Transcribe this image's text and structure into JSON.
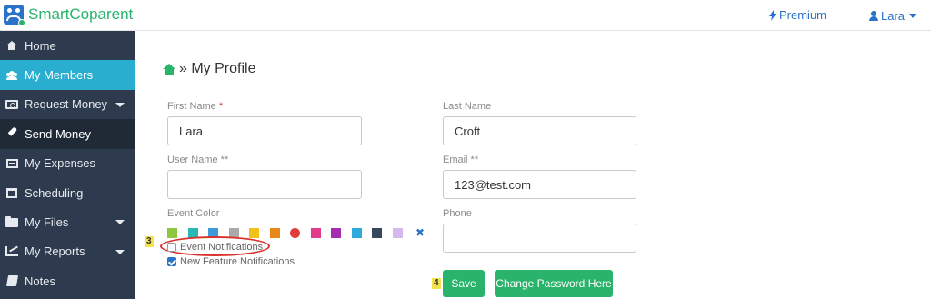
{
  "app": {
    "name": "SmartCoparent"
  },
  "header": {
    "premium_label": "Premium",
    "user_label": "Lara"
  },
  "sidebar": {
    "items": [
      {
        "label": "Home"
      },
      {
        "label": "My Members"
      },
      {
        "label": "Request Money"
      },
      {
        "label": "Send Money"
      },
      {
        "label": "My Expenses"
      },
      {
        "label": "Scheduling"
      },
      {
        "label": "My Files"
      },
      {
        "label": "My Reports"
      },
      {
        "label": "Notes"
      }
    ]
  },
  "main": {
    "breadcrumb": "» My Profile",
    "form": {
      "first_name_label": "First Name",
      "required_marker": "*",
      "first_name_value": "Lara",
      "last_name_label": "Last Name",
      "last_name_value": "Croft",
      "user_name_label": "User Name **",
      "user_name_value": "",
      "email_label": "Email **",
      "email_value": "123@test.com",
      "event_color_label": "Event Color",
      "phone_label": "Phone",
      "phone_value": "",
      "event_colors": [
        "#8dc63f",
        "#2bb7b3",
        "#3f9ad9",
        "#aaaaaa",
        "#f2c21a",
        "#e8861a",
        "#e23b3b",
        "#e23b8a",
        "#a52fb0",
        "#2fa9d9",
        "#35485c",
        "#d6b8f0"
      ],
      "event_notifications_label": "Event Notifications",
      "event_notifications_checked": false,
      "new_feature_label": "New Feature Notifications",
      "new_feature_checked": true,
      "save_label": "Save",
      "change_password_label": "Change Password Here"
    },
    "annotations": {
      "badge_3": "3",
      "badge_4": "4"
    }
  },
  "colors": {
    "brand_green": "#29b36b",
    "brand_blue": "#2a73c9",
    "sidebar_bg": "#2e3b4e",
    "sidebar_active": "#2aaed0",
    "annotation_red": "#d9322a"
  }
}
